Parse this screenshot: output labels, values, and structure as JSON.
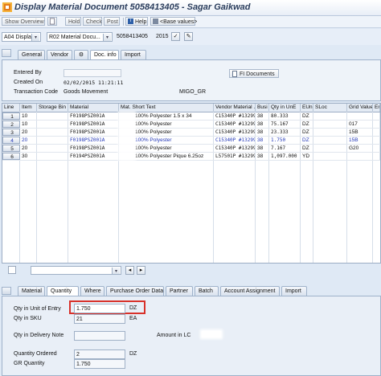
{
  "window": {
    "title": "Display Material Document 5058413405 - Sagar Gaikwad"
  },
  "toolbar": {
    "show_overview": "Show Overview",
    "hold": "Hold",
    "check": "Check",
    "post": "Post",
    "help": "Help",
    "base_values": "<Base values>"
  },
  "header_fields": {
    "action": "A04 Display",
    "reference": "R02 Material Docu...",
    "document_number": "5058413405",
    "year": "2015"
  },
  "header_tabs": [
    "General",
    "Vendor",
    "Doc. info",
    "Import"
  ],
  "doc_info": {
    "entered_by_label": "Entered By",
    "created_on_label": "Created On",
    "created_on_value": "02/02/2015 11:21:11",
    "transaction_code_label": "Transaction Code",
    "transaction_code_value": "Goods Movement",
    "transaction_code_tcode": "MIGO_GR",
    "fi_documents_button": "FI Documents"
  },
  "items_table": {
    "columns": [
      "Line",
      "Item",
      "Storage Bin",
      "Material",
      "Mat. Short Text",
      "Vendor Material ...",
      "Busi",
      "Qty in UnE",
      "EUn",
      "SLoc",
      "Grid Value",
      "Er"
    ],
    "rows": [
      {
        "line": "1",
        "item": "10",
        "bin": "",
        "material": "F0198PSZ001A",
        "short_text": "100% Polyester 1.5 x 34",
        "vendor_material": "C15340P #13299...",
        "busi": "38",
        "qty": "80.333",
        "eun": "DZ",
        "sloc": "",
        "grid": "",
        "highlight": false
      },
      {
        "line": "2",
        "item": "10",
        "bin": "",
        "material": "F0198PSZ001A",
        "short_text": "100% Polyester",
        "vendor_material": "C15340P #13299...",
        "busi": "38",
        "qty": "75.167",
        "eun": "DZ",
        "sloc": "",
        "grid": "017",
        "highlight": false
      },
      {
        "line": "3",
        "item": "20",
        "bin": "",
        "material": "F0198PSZ001A",
        "short_text": "100% Polyester",
        "vendor_material": "C15340P #13299...",
        "busi": "38",
        "qty": "23.333",
        "eun": "DZ",
        "sloc": "",
        "grid": "15B",
        "highlight": false
      },
      {
        "line": "4",
        "item": "20",
        "bin": "",
        "material": "F0198PSZ001A",
        "short_text": "100% Polyester",
        "vendor_material": "C15340P #13299...",
        "busi": "38",
        "qty": "1.750",
        "eun": "DZ",
        "sloc": "",
        "grid": "15B",
        "highlight": true
      },
      {
        "line": "5",
        "item": "20",
        "bin": "",
        "material": "F0198PSZ001A",
        "short_text": "100% Polyester",
        "vendor_material": "C15340P #13299...",
        "busi": "38",
        "qty": "7.167",
        "eun": "DZ",
        "sloc": "",
        "grid": "G20",
        "highlight": false
      },
      {
        "line": "6",
        "item": "30",
        "bin": "",
        "material": "F0194PSZ001A",
        "short_text": "100% Polyester Pique 6.25oz",
        "vendor_material": "L57501P #13299...",
        "busi": "38",
        "qty": "1,097.000",
        "eun": "YD",
        "sloc": "",
        "grid": "",
        "highlight": false
      }
    ]
  },
  "bottom_tabs": [
    "Material",
    "Quantity",
    "Where",
    "Purchase Order Data",
    "Partner",
    "Batch",
    "Account Assignment",
    "Import"
  ],
  "quantity": {
    "qty_unit_entry_label": "Qty in Unit of Entry",
    "qty_unit_entry_value": "1.750",
    "qty_unit_entry_unit": "DZ",
    "qty_sku_label": "Qty in SKU",
    "qty_sku_value": "21",
    "qty_sku_unit": "EA",
    "qty_delivery_note_label": "Qty in Delivery Note",
    "amount_lc_label": "Amount in LC",
    "quantity_ordered_label": "Quantity Ordered",
    "quantity_ordered_value": "2",
    "quantity_ordered_unit": "DZ",
    "gr_quantity_label": "GR Quantity",
    "gr_quantity_value": "1.750"
  },
  "colors": {
    "highlight_border": "#d8312a",
    "selected_row_text": "#2439b8"
  }
}
